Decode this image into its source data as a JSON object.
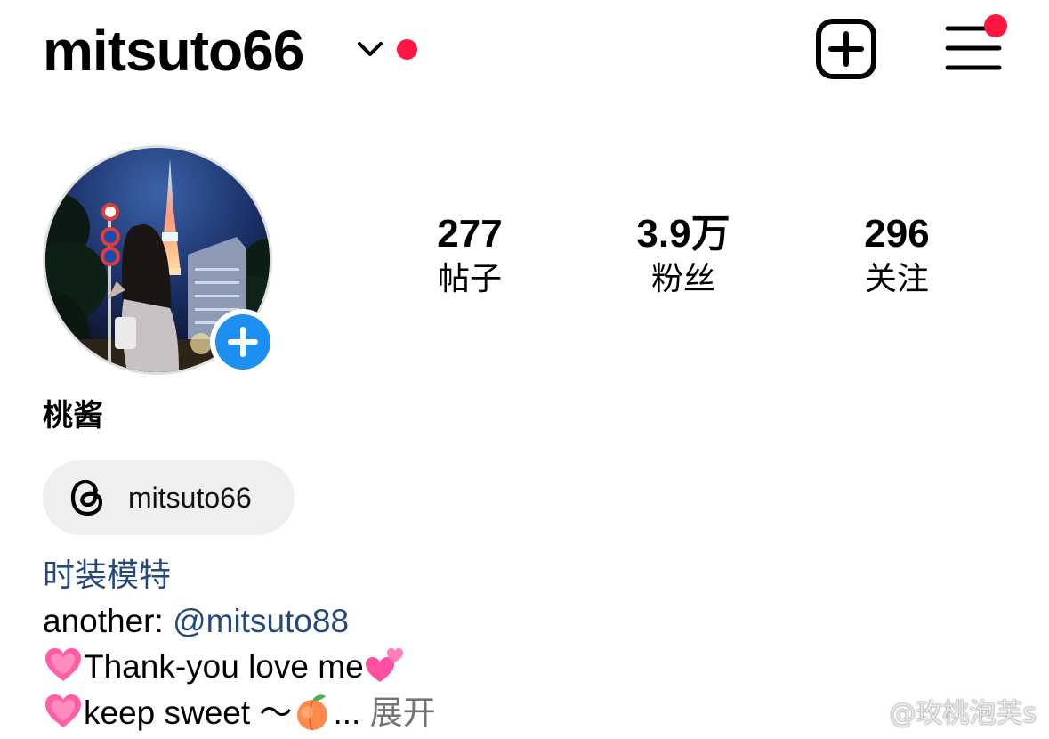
{
  "header": {
    "username": "mitsuto66",
    "new_post_icon": "plus-square-icon",
    "menu_icon": "hamburger-menu-icon",
    "notification_color": "#ff1744"
  },
  "profile": {
    "display_name": "桃酱",
    "avatar_icon": "profile-photo",
    "add_story_icon": "plus-icon"
  },
  "stats": {
    "posts": {
      "value": "277",
      "label": "帖子"
    },
    "followers": {
      "value": "3.9万",
      "label": "粉丝"
    },
    "following": {
      "value": "296",
      "label": "关注"
    }
  },
  "threads": {
    "icon": "threads-icon",
    "handle": "mitsuto66"
  },
  "bio": {
    "category": "时装模特",
    "another_prefix": "another: ",
    "mention": "@mitsuto88",
    "line_thanks": "Thank-you love me",
    "line_sweet": "keep sweet ～",
    "ellipsis": "... ",
    "more": "展开"
  },
  "watermark": {
    "text": "@玫桃泡芙s",
    "icon": "weibo-icon"
  },
  "colors": {
    "link": "#24497a",
    "accent_blue": "#1d8ff0",
    "muted": "#737373",
    "chip_bg": "#efefef"
  }
}
